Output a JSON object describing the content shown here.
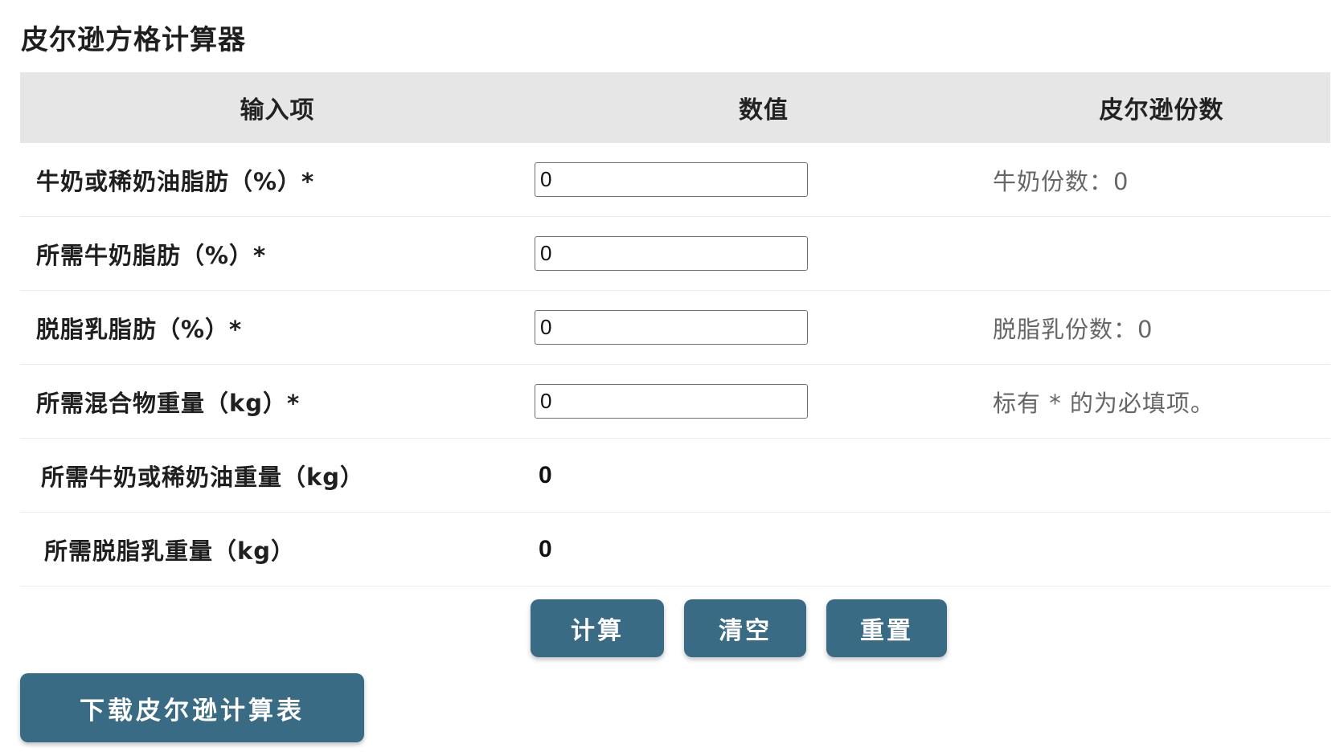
{
  "page": {
    "title": "皮尔逊方格计算器"
  },
  "table": {
    "headers": {
      "label": "输入项",
      "value": "数值",
      "pearson": "皮尔逊份数"
    },
    "rows": [
      {
        "label": "牛奶或稀奶油脂肪（%）*",
        "input_value": "0",
        "pearson": "牛奶份数：0"
      },
      {
        "label": "所需牛奶脂肪（%）*",
        "input_value": "0",
        "pearson": ""
      },
      {
        "label": "脱脂乳脂肪（%）*",
        "input_value": "0",
        "pearson": "脱脂乳份数：0"
      },
      {
        "label": "所需混合物重量（kg）*",
        "input_value": "0",
        "pearson": "标有 * 的为必填项。"
      }
    ],
    "results": [
      {
        "label": "所需牛奶或稀奶油重量（kg）",
        "value": "0"
      },
      {
        "label": "所需脱脂乳重量（kg）",
        "value": "0"
      }
    ]
  },
  "actions": {
    "calculate": "计算",
    "clear": "清空",
    "reset": "重置"
  },
  "download": {
    "label": "下载皮尔逊计算表"
  },
  "colors": {
    "button": "#3a6b85",
    "header_bg": "#e6e6e6"
  }
}
